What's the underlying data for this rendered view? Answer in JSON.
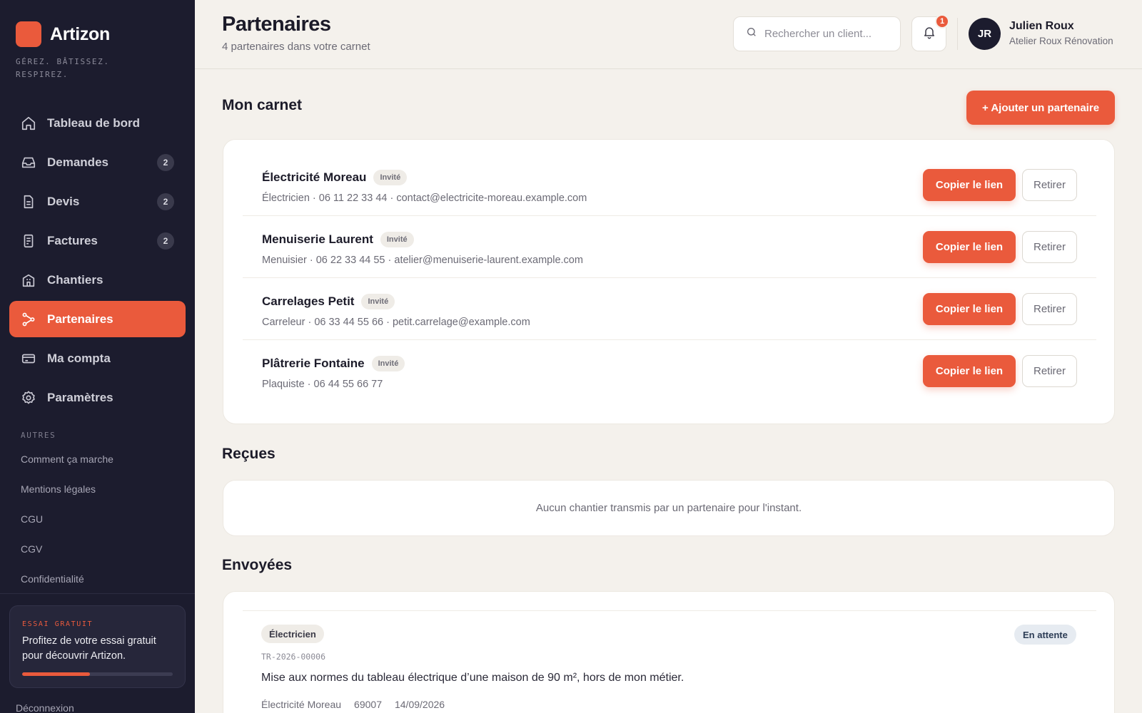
{
  "brand": {
    "name": "Artizon",
    "tagline": "GÉREZ. BÂTISSEZ. RESPIREZ."
  },
  "nav": [
    {
      "label": "Tableau de bord",
      "icon": "home-icon",
      "badge": ""
    },
    {
      "label": "Demandes",
      "icon": "inbox-icon",
      "badge": "2"
    },
    {
      "label": "Devis",
      "icon": "document-icon",
      "badge": "2"
    },
    {
      "label": "Factures",
      "icon": "receipt-icon",
      "badge": "2"
    },
    {
      "label": "Chantiers",
      "icon": "building-icon",
      "badge": ""
    },
    {
      "label": "Partenaires",
      "icon": "share-icon",
      "badge": "",
      "active": true
    },
    {
      "label": "Ma compta",
      "icon": "credit-card-icon",
      "badge": ""
    },
    {
      "label": "Paramètres",
      "icon": "gear-icon",
      "badge": ""
    }
  ],
  "autres": {
    "title": "AUTRES",
    "links": [
      "Comment ça marche",
      "Mentions légales",
      "CGU",
      "CGV",
      "Confidentialité"
    ]
  },
  "trial": {
    "kicker": "ESSAI GRATUIT",
    "text": "Profitez de votre essai gratuit pour découvrir Artizon.",
    "progress": 0.45
  },
  "logout": "Déconnexion",
  "header": {
    "title": "Partenaires",
    "subtitle": "4 partenaires dans votre carnet",
    "search_placeholder": "Rechercher un client...",
    "notifications_count": "1",
    "user": {
      "initials": "JR",
      "name": "Julien Roux",
      "company": "Atelier Roux Rénovation"
    }
  },
  "carnet": {
    "title": "Mon carnet",
    "add_label": "+ Ajouter un partenaire",
    "copy_label": "Copier le lien",
    "remove_label": "Retirer",
    "partners": [
      {
        "name": "Électricité Moreau",
        "badge": "Invité",
        "meta": "Électricien · 06 11 22 33 44 · contact@electricite-moreau.example.com"
      },
      {
        "name": "Menuiserie Laurent",
        "badge": "Invité",
        "meta": "Menuisier · 06 22 33 44 55 · atelier@menuiserie-laurent.example.com"
      },
      {
        "name": "Carrelages Petit",
        "badge": "Invité",
        "meta": "Carreleur · 06 33 44 55 66 · petit.carrelage@example.com"
      },
      {
        "name": "Plâtrerie Fontaine",
        "badge": "Invité",
        "meta": "Plaquiste · 06 44 55 66 77"
      }
    ]
  },
  "recues": {
    "title": "Reçues",
    "empty": "Aucun chantier transmis par un partenaire pour l'instant."
  },
  "envoyees": {
    "title": "Envoyées",
    "item": {
      "trade": "Électricien",
      "status": "En attente",
      "ref": "TR-2026-00006",
      "description": "Mise aux normes du tableau électrique d’une maison de 90 m², hors de mon métier.",
      "partner": "Électricité Moreau",
      "postcode": "69007",
      "date": "14/09/2026"
    }
  },
  "colors": {
    "accent": "#ea5a3c",
    "sidebar": "#1c1c2e",
    "background": "#f4f1ec"
  }
}
